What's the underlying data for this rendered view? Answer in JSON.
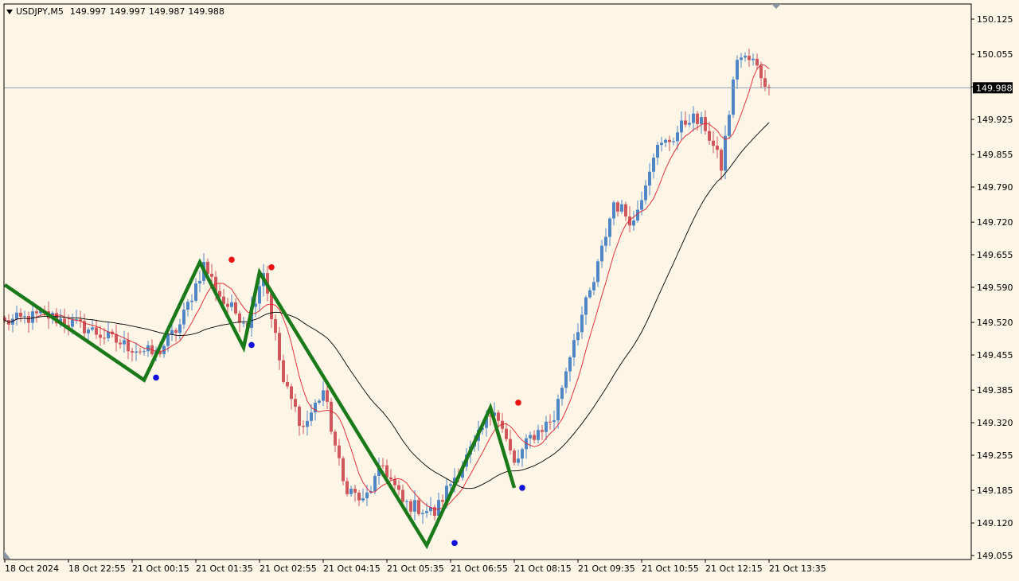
{
  "header": {
    "symbol": "USDJPY,M5",
    "open": "149.997",
    "high": "149.997",
    "low": "149.987",
    "close": "149.988"
  },
  "colors": {
    "background": "#fdf5e6",
    "bull_candle": "#4f86c6",
    "bear_candle": "#d0575c",
    "fast_ma": "#e0202a",
    "slow_ma": "#000000",
    "zigzag": "#1a7a1a",
    "fractal_up": "#ee1111",
    "fractal_down": "#1111dd",
    "current_price_line": "#8a9bb0",
    "price_tag_bg": "#000000"
  },
  "icons": {
    "header_dropdown": "triangle-down-icon",
    "chart_shift_marker": "triangle-down-icon",
    "scroll_marker": "triangle-icon"
  },
  "chart_data": {
    "type": "candlestick",
    "timeframe": "M5",
    "current_price": "149.988",
    "y_axis": {
      "range": [
        149.055,
        150.125
      ],
      "ticks": [
        "150.125",
        "150.055",
        "149.990",
        "149.925",
        "149.855",
        "149.790",
        "149.720",
        "149.655",
        "149.590",
        "149.520",
        "149.455",
        "149.385",
        "149.320",
        "149.255",
        "149.185",
        "149.120",
        "149.055"
      ]
    },
    "x_axis": {
      "ticks": [
        "18 Oct 2024",
        "18 Oct 22:55",
        "21 Oct 00:15",
        "21 Oct 01:35",
        "21 Oct 02:55",
        "21 Oct 04:15",
        "21 Oct 05:35",
        "21 Oct 06:55",
        "21 Oct 08:15",
        "21 Oct 09:35",
        "21 Oct 10:55",
        "21 Oct 12:15",
        "21 Oct 13:35"
      ],
      "bars_per_tick": 16,
      "total_bars": 193
    },
    "price_keypoints": [
      {
        "bar": 0,
        "price": 149.52
      },
      {
        "bar": 10,
        "price": 149.535
      },
      {
        "bar": 20,
        "price": 149.51
      },
      {
        "bar": 30,
        "price": 149.475
      },
      {
        "bar": 38,
        "price": 149.455
      },
      {
        "bar": 44,
        "price": 149.515
      },
      {
        "bar": 50,
        "price": 149.635
      },
      {
        "bar": 55,
        "price": 149.56
      },
      {
        "bar": 61,
        "price": 149.52
      },
      {
        "bar": 65,
        "price": 149.625
      },
      {
        "bar": 70,
        "price": 149.4
      },
      {
        "bar": 75,
        "price": 149.31
      },
      {
        "bar": 80,
        "price": 149.385
      },
      {
        "bar": 85,
        "price": 149.2
      },
      {
        "bar": 90,
        "price": 149.16
      },
      {
        "bar": 95,
        "price": 149.235
      },
      {
        "bar": 100,
        "price": 149.16
      },
      {
        "bar": 108,
        "price": 149.14
      },
      {
        "bar": 112,
        "price": 149.2
      },
      {
        "bar": 118,
        "price": 149.275
      },
      {
        "bar": 123,
        "price": 149.355
      },
      {
        "bar": 128,
        "price": 149.235
      },
      {
        "bar": 132,
        "price": 149.29
      },
      {
        "bar": 138,
        "price": 149.33
      },
      {
        "bar": 143,
        "price": 149.49
      },
      {
        "bar": 148,
        "price": 149.6
      },
      {
        "bar": 153,
        "price": 149.76
      },
      {
        "bar": 158,
        "price": 149.72
      },
      {
        "bar": 163,
        "price": 149.86
      },
      {
        "bar": 168,
        "price": 149.89
      },
      {
        "bar": 172,
        "price": 149.93
      },
      {
        "bar": 176,
        "price": 149.91
      },
      {
        "bar": 180,
        "price": 149.83
      },
      {
        "bar": 184,
        "price": 150.05
      },
      {
        "bar": 188,
        "price": 150.04
      },
      {
        "bar": 192,
        "price": 149.988
      }
    ],
    "zigzag": [
      {
        "bar": 0,
        "price": 149.595
      },
      {
        "bar": 35,
        "price": 149.405
      },
      {
        "bar": 49,
        "price": 149.64
      },
      {
        "bar": 60,
        "price": 149.47
      },
      {
        "bar": 64,
        "price": 149.62
      },
      {
        "bar": 106,
        "price": 149.075
      },
      {
        "bar": 122,
        "price": 149.35
      },
      {
        "bar": 128,
        "price": 149.19
      }
    ],
    "fractals": [
      {
        "kind": "up",
        "bar": 57,
        "price": 149.645
      },
      {
        "kind": "up",
        "bar": 67,
        "price": 149.63
      },
      {
        "kind": "up",
        "bar": 129,
        "price": 149.36
      },
      {
        "kind": "down",
        "bar": 38,
        "price": 149.41
      },
      {
        "kind": "down",
        "bar": 62,
        "price": 149.475
      },
      {
        "kind": "down",
        "bar": 113,
        "price": 149.08
      },
      {
        "kind": "down",
        "bar": 130,
        "price": 149.19
      }
    ],
    "moving_averages": [
      {
        "period": 8,
        "color": "#e0202a"
      },
      {
        "period": 34,
        "color": "#000000"
      }
    ]
  }
}
